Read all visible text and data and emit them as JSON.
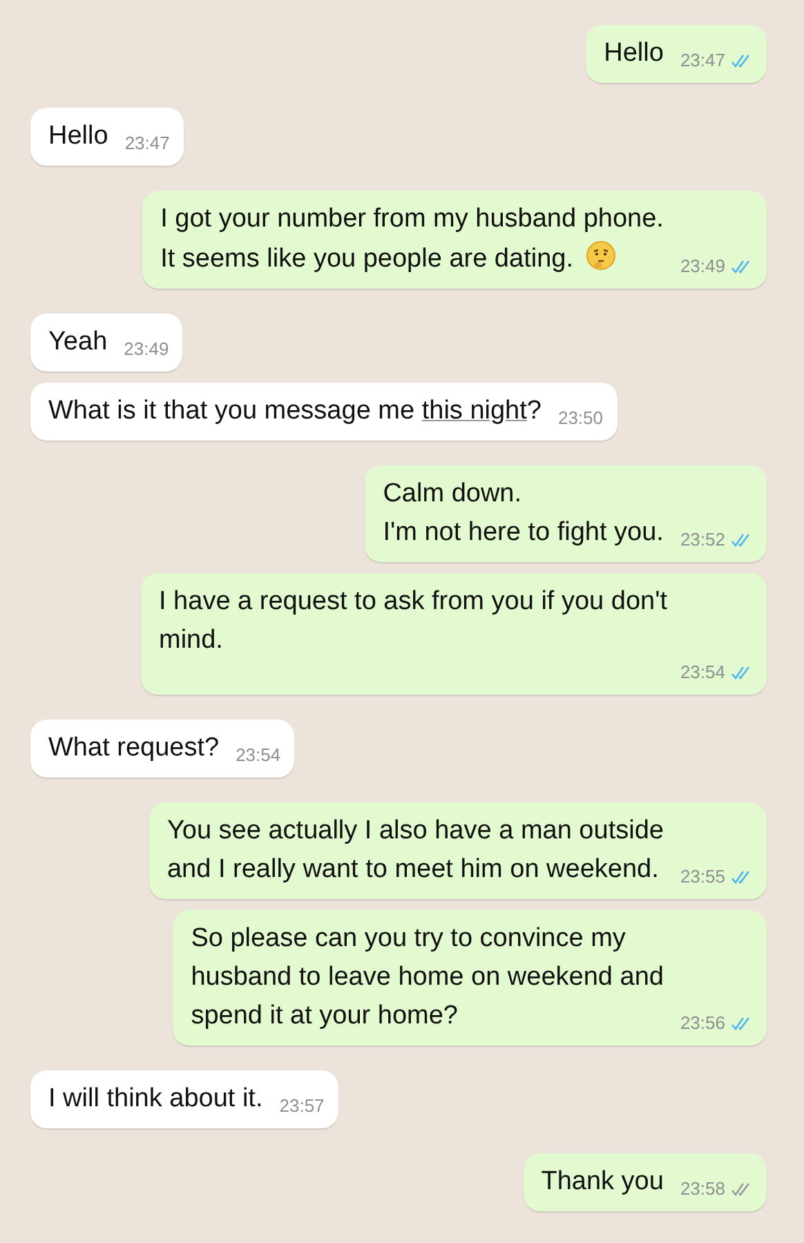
{
  "messages": [
    {
      "kind": "outgoing",
      "parts": [
        {
          "kind": "text",
          "text": "Hello"
        }
      ],
      "time": "23:47",
      "read": true
    },
    {
      "kind": "incoming",
      "parts": [
        {
          "kind": "text",
          "text": "Hello"
        }
      ],
      "time": "23:47"
    },
    {
      "kind": "outgoing",
      "parts": [
        {
          "kind": "text",
          "text": "I got your number from my husband phone.\nIt seems like you people are dating."
        }
      ],
      "emoji": true,
      "time": "23:49",
      "read": true
    },
    {
      "kind": "incoming",
      "parts": [
        {
          "kind": "text",
          "text": "Yeah"
        }
      ],
      "time": "23:49"
    },
    {
      "kind": "incoming",
      "parts": [
        {
          "kind": "text",
          "text": "What is it that you message me "
        },
        {
          "kind": "link",
          "text": "this night"
        },
        {
          "kind": "text",
          "text": "?"
        }
      ],
      "time": "23:50"
    },
    {
      "kind": "outgoing",
      "parts": [
        {
          "kind": "text",
          "text": "Calm down.\nI'm not here to fight you."
        }
      ],
      "time": "23:52",
      "read": true
    },
    {
      "kind": "outgoing",
      "parts": [
        {
          "kind": "text",
          "text": "I have a request to ask from you if you don't\nmind."
        }
      ],
      "time": "23:54",
      "read": true
    },
    {
      "kind": "incoming",
      "parts": [
        {
          "kind": "text",
          "text": "What request?"
        }
      ],
      "time": "23:54"
    },
    {
      "kind": "outgoing",
      "parts": [
        {
          "kind": "text",
          "text": "You see actually I also have a man outside\nand I really want to meet him on weekend."
        }
      ],
      "time": "23:55",
      "read": true
    },
    {
      "kind": "outgoing",
      "parts": [
        {
          "kind": "text",
          "text": "So please can you try to convince my\nhusband to leave home on weekend and\nspend it at your home?"
        }
      ],
      "time": "23:56",
      "read": true
    },
    {
      "kind": "incoming",
      "parts": [
        {
          "kind": "text",
          "text": "I will think about it."
        }
      ],
      "time": "23:57"
    },
    {
      "kind": "outgoing",
      "parts": [
        {
          "kind": "text",
          "text": "Thank you"
        }
      ],
      "time": "23:58",
      "read": false
    }
  ]
}
